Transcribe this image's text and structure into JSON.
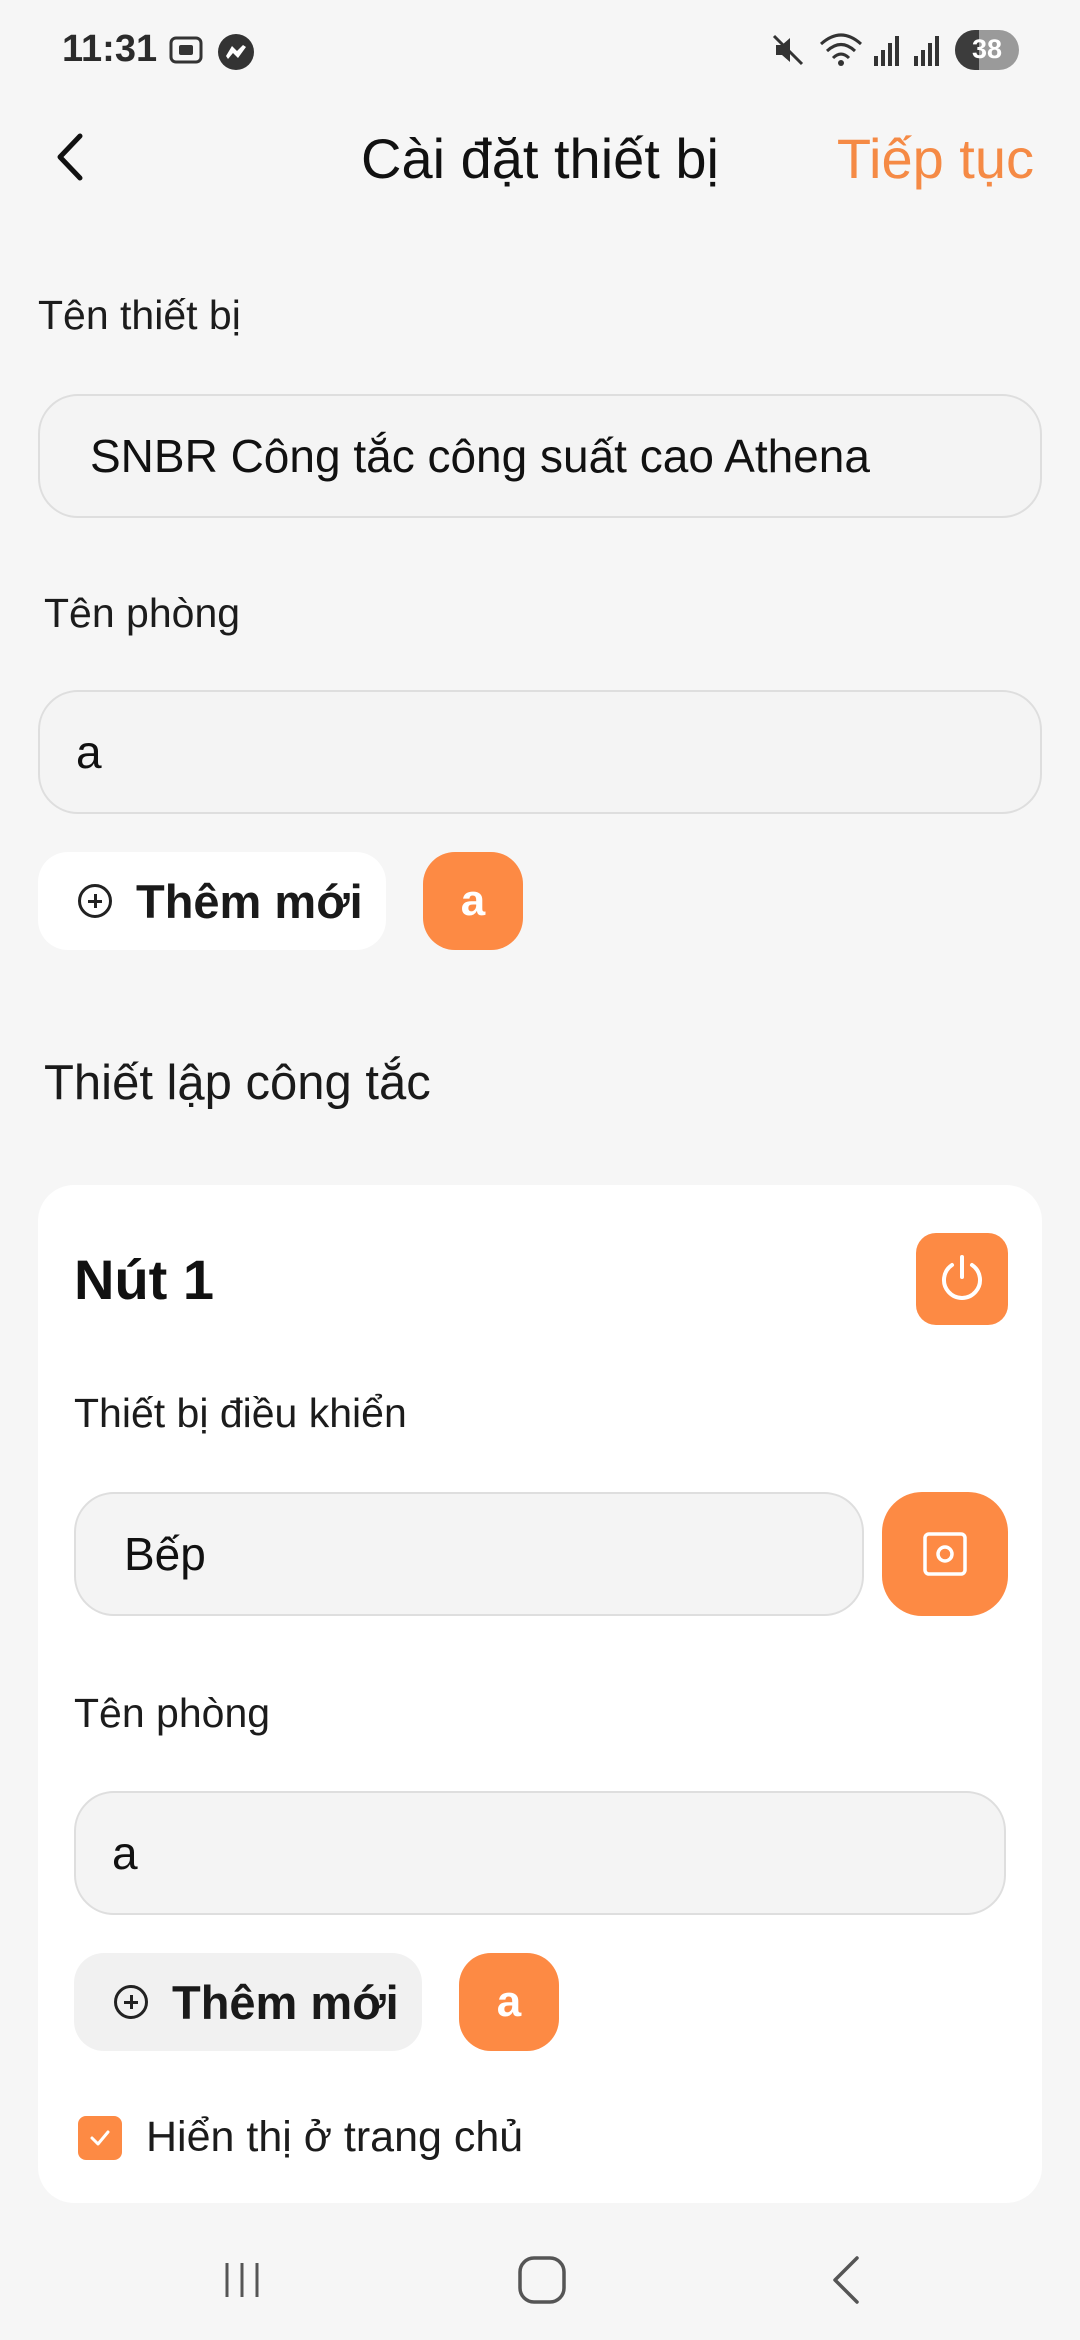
{
  "status_bar": {
    "time": "11:31",
    "battery_level": "38",
    "icons": [
      "screenshot-icon",
      "messenger-icon",
      "mute-icon",
      "wifi-icon",
      "signal-icon",
      "signal-icon"
    ]
  },
  "header": {
    "title": "Cài đặt thiết bị",
    "continue_label": "Tiếp tục"
  },
  "device": {
    "name_label": "Tên thiết bị",
    "name_value": "SNBR Công tắc công suất cao Athena",
    "room_label": "Tên phòng",
    "room_value": "a",
    "add_new_label": "Thêm mới",
    "room_chips": [
      "a"
    ]
  },
  "switch_section": {
    "title": "Thiết lập công tắc",
    "buttons": [
      {
        "title": "Nút 1",
        "control_device_label": "Thiết bị điều khiển",
        "control_device_value": "Bếp",
        "room_label": "Tên phòng",
        "room_value": "a",
        "add_new_label": "Thêm mới",
        "room_chips": [
          "a"
        ],
        "show_on_home_label": "Hiển thị ở trang chủ",
        "show_on_home_checked": true
      }
    ]
  },
  "colors": {
    "accent": "#fd8a44",
    "accent_text": "#f58a45",
    "background": "#f6f6f6",
    "card": "#ffffff"
  }
}
